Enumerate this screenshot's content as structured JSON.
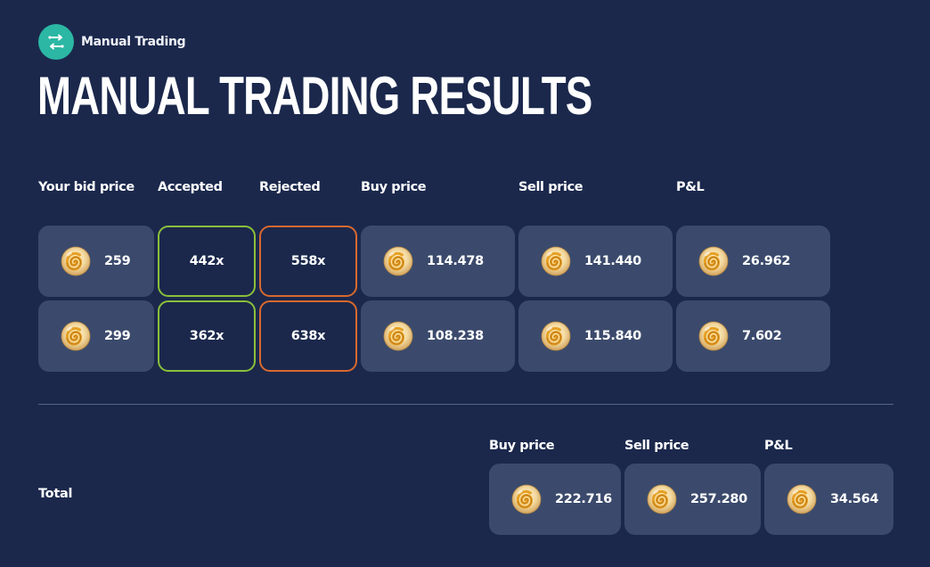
{
  "header": {
    "badge_label": "Manual Trading",
    "badge_icon": "swap-arrows-icon",
    "title": "MANUAL TRADING RESULTS"
  },
  "columns": {
    "bid": "Your bid price",
    "accepted": "Accepted",
    "rejected": "Rejected",
    "buy": "Buy price",
    "sell": "Sell price",
    "pnl": "P&L"
  },
  "rows": [
    {
      "bid": "259",
      "accepted": "442x",
      "rejected": "558x",
      "buy": "114.478",
      "sell": "141.440",
      "pnl": "26.962"
    },
    {
      "bid": "299",
      "accepted": "362x",
      "rejected": "638x",
      "buy": "108.238",
      "sell": "115.840",
      "pnl": "7.602"
    }
  ],
  "total": {
    "label": "Total",
    "buy_label": "Buy price",
    "sell_label": "Sell price",
    "pnl_label": "P&L",
    "buy": "222.716",
    "sell": "257.280",
    "pnl": "34.564"
  },
  "currency_icon": "shell-icon",
  "colors": {
    "background": "#1b284c",
    "card": "#3b4a6c",
    "accent": "#2bb7a4",
    "accepted_border": "#8ac03a",
    "rejected_border": "#d9692e"
  }
}
